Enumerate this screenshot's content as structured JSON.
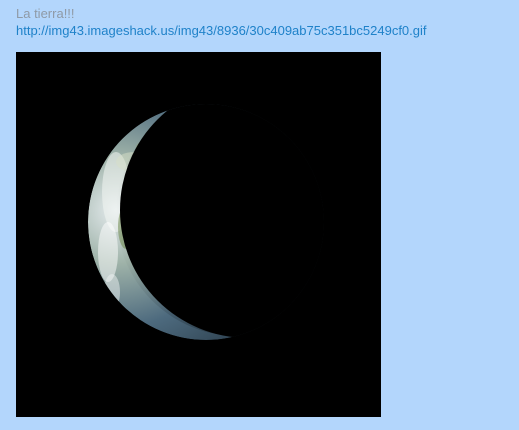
{
  "post": {
    "text": "La tierra!!!",
    "link": "http://img43.imageshack.us/img43/8936/30c409ab75c351bc5249cf0.gif"
  },
  "colors": {
    "background": "#b3d6fc",
    "text": "#8f9aa6",
    "link": "#1f82c9",
    "image_background": "#000000"
  }
}
